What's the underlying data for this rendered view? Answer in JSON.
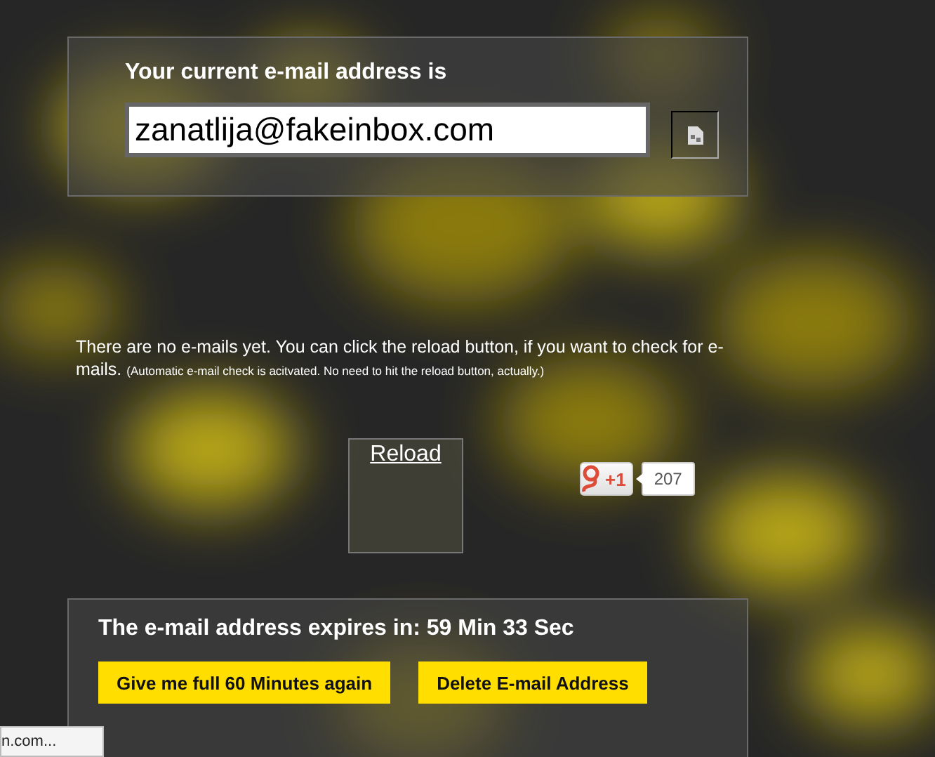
{
  "address_panel": {
    "heading": "Your current e-mail address is",
    "email": "zanatlija@fakeinbox.com"
  },
  "notice": {
    "text": "There are no e-mails yet. You can click the reload button, if you want to check for e-mails.",
    "note": "(Automatic e-mail check is acitvated. No need to hit the reload button, actually.)"
  },
  "reload": {
    "label": "Reload"
  },
  "plus_one": {
    "label": "+1",
    "count": "207"
  },
  "expiry_panel": {
    "text": "The e-mail address expires in: 59 Min 33 Sec",
    "buttons": [
      "Give me full 60 Minutes again",
      "Delete E-mail Address"
    ]
  },
  "status_bar": {
    "url": "n.com..."
  }
}
